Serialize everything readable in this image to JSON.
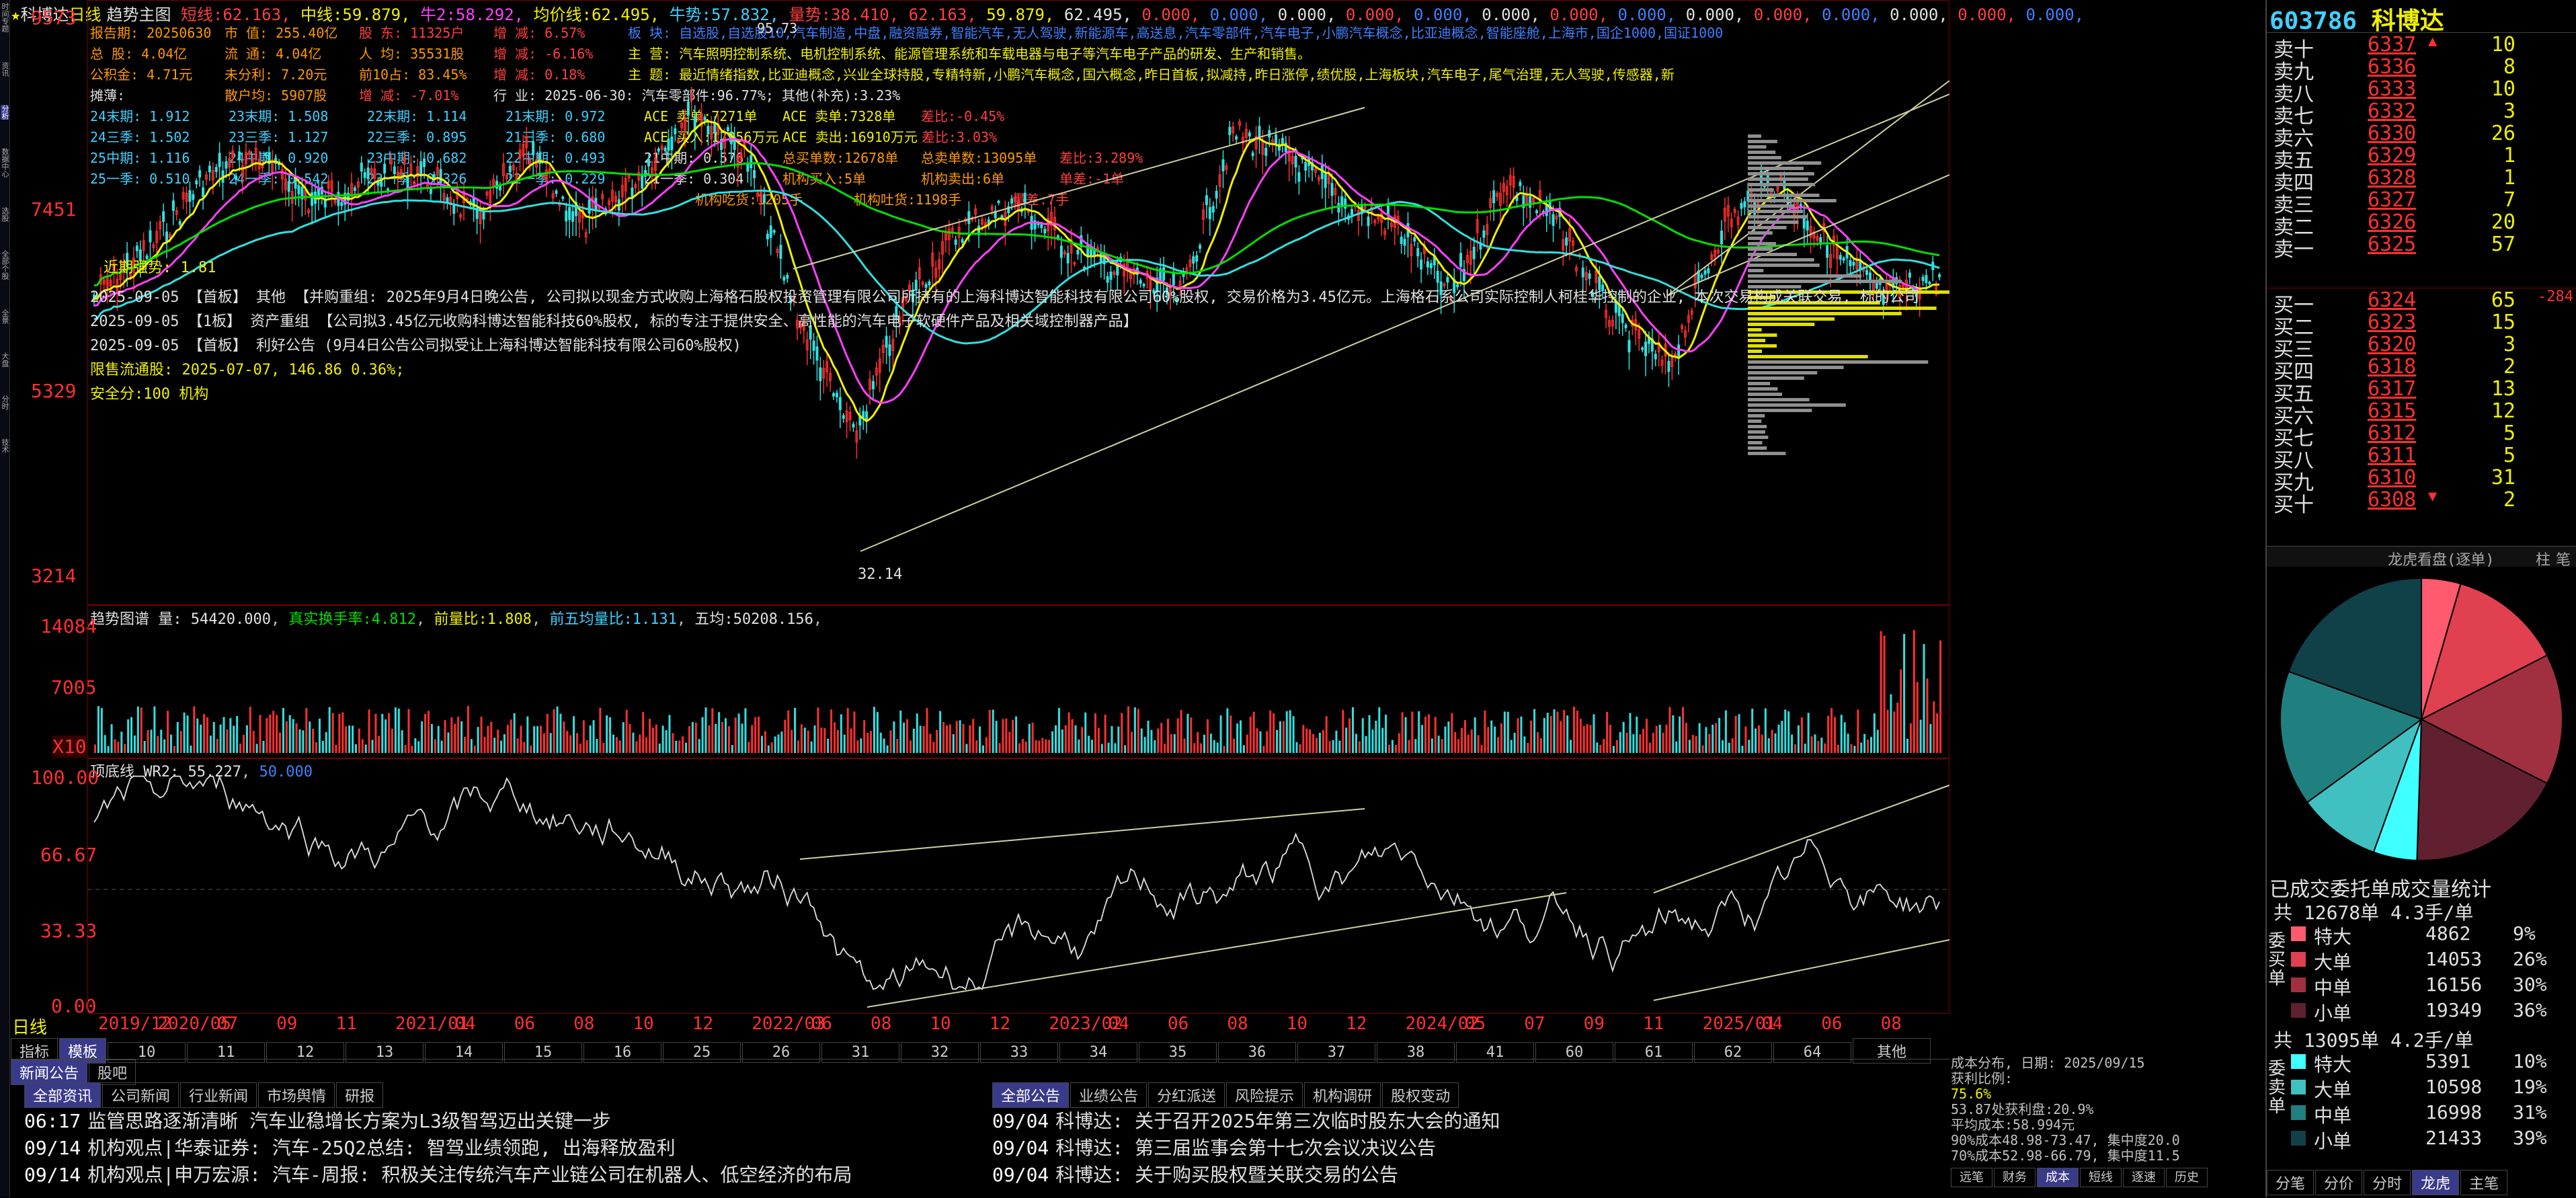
{
  "stock": {
    "code": "603786",
    "name": "科博达",
    "period": "日线",
    "theme": "趋势主图"
  },
  "header_ma": [
    {
      "label": "短线:",
      "value": "62.163",
      "color": "#ff4040"
    },
    {
      "label": "中线:",
      "value": "59.879",
      "color": "#f0f000"
    },
    {
      "label": "牛2:",
      "value": "58.292",
      "color": "#ff40ff"
    },
    {
      "label": "均价线:",
      "value": "62.495",
      "color": "#f0f000"
    },
    {
      "label": "牛势:",
      "value": "57.832",
      "color": "#40d0ff"
    },
    {
      "label": "量势:",
      "value": "38.410",
      "color": "#ff4040"
    },
    {
      "label": "",
      "value": "62.163",
      "color": "#ff4040"
    },
    {
      "label": "",
      "value": "59.879",
      "color": "#f0f000"
    },
    {
      "label": "",
      "value": "62.495",
      "color": "#e0e0e0"
    }
  ],
  "header_zero": "0.000",
  "info_rows": [
    [
      {
        "t": "报告期: 20250630",
        "c": "#ff9900"
      },
      {
        "t": "市 值: 255.40亿",
        "c": "#ff9900"
      },
      {
        "t": "股 东: 11325户",
        "c": "#ff4040"
      },
      {
        "t": "增 减: 6.57%",
        "c": "#ff4040"
      },
      {
        "t": "板 块: 自选股,自选股10,汽车制造,中盘,融资融券,智能汽车,无人驾驶,新能源车,高送息,汽车零部件,汽车电子,小鹏汽车概念,比亚迪概念,智能座舱,上海市,国企1000,国证1000",
        "c": "#4080ff"
      }
    ],
    [
      {
        "t": "总 股: 4.04亿",
        "c": "#ff9900"
      },
      {
        "t": "流 通: 4.04亿",
        "c": "#ff9900"
      },
      {
        "t": "人 均: 35531股",
        "c": "#ff9900"
      },
      {
        "t": "增 减: -6.16%",
        "c": "#ff4040"
      },
      {
        "t": "主 营: 汽车照明控制系统、电机控制系统、能源管理系统和车载电器与电子等汽车电子产品的研发、生产和销售。",
        "c": "#f0f000"
      }
    ],
    [
      {
        "t": "公积金: 4.71元",
        "c": "#ff9900"
      },
      {
        "t": "未分利: 7.20元",
        "c": "#ff9900"
      },
      {
        "t": "前10占: 83.45%",
        "c": "#ff9900"
      },
      {
        "t": "增 减: 0.18%",
        "c": "#ff4040"
      },
      {
        "t": "主 题: 最近情绪指数,比亚迪概念,兴业全球持股,专精特新,小鹏汽车概念,国六概念,昨日首板,拟减持,昨日涨停,绩优股,上海板块,汽车电子,尾气治理,无人驾驶,传感器,新",
        "c": "#f0f000"
      }
    ],
    [
      {
        "t": "摊薄:",
        "c": "#e0e0e0"
      },
      {
        "t": "散户均: 5907股",
        "c": "#ff9900"
      },
      {
        "t": "增 减: -7.01%",
        "c": "#ff4040"
      },
      {
        "t": "行 业: 2025-06-30: 汽车零部件:96.77%; 其他(补充):3.23%",
        "c": "#e0e0e0"
      }
    ]
  ],
  "stats_rows": [
    [
      "24末期: 1.912",
      "23末期: 1.508",
      "22末期: 1.114",
      "21末期: 0.972",
      "ACE 卖单:7271单",
      "ACE 卖单:7328单",
      "差比:-0.45%"
    ],
    [
      "24三季: 1.502",
      "23三季: 1.127",
      "22三季: 0.895",
      "21三季: 0.680",
      "ACE 买入:17956万元",
      "ACE 卖出:16910万元",
      "差比:3.03%"
    ],
    [
      "25中期: 1.116",
      "24中期: 0.920",
      "23中期: 0.682",
      "22中期: 0.493",
      "21中期: 0.576",
      "总买单数:12678单",
      "总卖单数:13095单",
      "差比:3.289%"
    ],
    [
      "25一季: 0.510",
      "24一季: 0.542",
      "23一季: 0.326",
      "22一季: 0.229",
      "21一季: 0.304",
      "机构买入:5单",
      "机构卖出:6单",
      "单差:-1单"
    ],
    [
      "机构吃货:1205手",
      "机构吐货:1198手",
      "量差:7手"
    ]
  ],
  "price_axis": [
    "9573",
    "7451",
    "5329",
    "3214"
  ],
  "price_notes": {
    "high_mark": "95.73",
    "low_mark": "32.14",
    "recent": "近期强势: 1.81"
  },
  "announcements": [
    "2025-09-05 【首板】 其他 【并购重组: 2025年9月4日晚公告, 公司拟以现金方式收购上海格石股权投资管理有限公司所持有的上海科博达智能科技有限公司60%股权, 交易价格为3.45亿元。上海格石系公司实际控制人柯桂华控制的企业, 本次交易构成关联交易, 标的公司",
    "2025-09-05 【1板】 资产重组 【公司拟3.45亿元收购科博达智能科技60%股权, 标的专注于提供安全、高性能的汽车电子软硬件产品及相关域控制器产品】",
    "2025-09-05 【首板】 利好公告 (9月4日公告公司拟受让上海科博达智能科技有限公司60%股权)",
    "限售流通股: 2025-07-07, 146.86 0.36%;",
    "安全分:100 机构"
  ],
  "volume": {
    "title": "趋势图谱 量:",
    "vol": "54420.000",
    "turn_label": "真实换手率:",
    "turn": "4.812",
    "vr_label": "前量比:",
    "vr": "1.808",
    "avg_label": "前五均量比:",
    "avg": "1.131",
    "five_label": "五均:",
    "five": "50208.156",
    "axis": [
      "14084",
      "7005",
      "X10"
    ]
  },
  "indicator": {
    "title": "顶底线 WR2:",
    "value": "55.227",
    "value2": "50.000",
    "axis": [
      "100.00",
      "66.67",
      "33.33",
      "0.00"
    ]
  },
  "date_axis": [
    "2019/12",
    "2020/05",
    "07",
    "09",
    "11",
    "2021/01",
    "04",
    "06",
    "08",
    "10",
    "12",
    "2022/03",
    "06",
    "08",
    "10",
    "12",
    "2023/02",
    "04",
    "06",
    "08",
    "10",
    "12",
    "2024/02",
    "05",
    "07",
    "09",
    "11",
    "2025/01",
    "04",
    "06",
    "08"
  ],
  "bottom_tabs": [
    "指标",
    "模板",
    "10",
    "11",
    "12",
    "13",
    "14",
    "15",
    "16",
    "25",
    "26",
    "31",
    "32",
    "33",
    "34",
    "35",
    "36",
    "37",
    "38",
    "41",
    "60",
    "61",
    "62",
    "64",
    "其他"
  ],
  "news_left": {
    "tabs": [
      "全部资讯",
      "公司新闻",
      "行业新闻",
      "市场舆情",
      "研报"
    ],
    "items": [
      {
        "time": "06:17",
        "text": "监管思路逐渐清晰 汽车业稳增长方案为L3级智驾迈出关键一步"
      },
      {
        "time": "09/14",
        "text": "机构观点|华泰证券: 汽车-25Q2总结: 智驾业绩领跑, 出海释放盈利"
      },
      {
        "time": "09/14",
        "text": "机构观点|申万宏源: 汽车-周报: 积极关注传统汽车产业链公司在机器人、低空经济的布局"
      }
    ]
  },
  "news_right": {
    "tabs": [
      "全部公告",
      "业绩公告",
      "分红派送",
      "风险提示",
      "机构调研",
      "股权变动"
    ],
    "items": [
      {
        "time": "09/04",
        "text": "科博达: 关于召开2025年第三次临时股东大会的通知"
      },
      {
        "time": "09/04",
        "text": "科博达: 第三届监事会第十七次会议决议公告"
      },
      {
        "time": "09/04",
        "text": "科博达: 关于购买股权暨关联交易的公告"
      }
    ]
  },
  "news_top_tabs": [
    "新闻公告",
    "股吧"
  ],
  "cost": {
    "lines": [
      "成本分布, 日期: 2025/09/15",
      "获利比例:",
      "75.6%",
      "53.87处获利盘:20.9%",
      "平均成本:58.994元",
      "90%成本48.98-73.47, 集中度20.0",
      "70%成本52.98-66.79, 集中度11.5"
    ],
    "tabs": [
      "远笔",
      "财务",
      "成本",
      "短线",
      "逐速",
      "历史"
    ]
  },
  "order_book": {
    "sell": [
      {
        "label": "卖十",
        "price": "6337",
        "vol": "10",
        "mark": "▲"
      },
      {
        "label": "卖九",
        "price": "6336",
        "vol": "8"
      },
      {
        "label": "卖八",
        "price": "6333",
        "vol": "10"
      },
      {
        "label": "卖七",
        "price": "6332",
        "vol": "3"
      },
      {
        "label": "卖六",
        "price": "6330",
        "vol": "26"
      },
      {
        "label": "卖五",
        "price": "6329",
        "vol": "1"
      },
      {
        "label": "卖四",
        "price": "6328",
        "vol": "1"
      },
      {
        "label": "卖三",
        "price": "6327",
        "vol": "7"
      },
      {
        "label": "卖二",
        "price": "6326",
        "vol": "20"
      },
      {
        "label": "卖一",
        "price": "6325",
        "vol": "57"
      }
    ],
    "buy": [
      {
        "label": "买一",
        "price": "6324",
        "vol": "65",
        "extra": "-284"
      },
      {
        "label": "买二",
        "price": "6323",
        "vol": "15"
      },
      {
        "label": "买三",
        "price": "6320",
        "vol": "3"
      },
      {
        "label": "买四",
        "price": "6318",
        "vol": "2"
      },
      {
        "label": "买五",
        "price": "6317",
        "vol": "13"
      },
      {
        "label": "买六",
        "price": "6315",
        "vol": "12"
      },
      {
        "label": "买七",
        "price": "6312",
        "vol": "5"
      },
      {
        "label": "买八",
        "price": "6311",
        "vol": "5"
      },
      {
        "label": "买九",
        "price": "6310",
        "vol": "31"
      },
      {
        "label": "买十",
        "price": "6308",
        "vol": "2",
        "mark": "▼"
      }
    ],
    "hand_mark": "手"
  },
  "pie_header": {
    "title": "龙虎看盘(逐单)",
    "tabs": [
      "柱",
      "笔"
    ]
  },
  "pie_data": [
    {
      "value": 9,
      "color": "#ff5a6e"
    },
    {
      "value": 26,
      "color": "#e04050"
    },
    {
      "value": 30,
      "color": "#a03040"
    },
    {
      "value": 36,
      "color": "#602030"
    },
    {
      "value": 10,
      "color": "#40ffff"
    },
    {
      "value": 19,
      "color": "#40c0c0"
    },
    {
      "value": 31,
      "color": "#208080"
    },
    {
      "value": 39,
      "color": "#104048"
    }
  ],
  "order_stats": {
    "title": "已成交委托单成交量统计",
    "buy_total": "共 12678单 4.3手/单",
    "sell_total": "共 13095单 4.2手/单",
    "side_buy": "委买单",
    "side_sell": "委卖单",
    "buy": [
      {
        "k": "特大",
        "v": "4862",
        "p": "9%",
        "color": "#ff5a6e"
      },
      {
        "k": "大单",
        "v": "14053",
        "p": "26%",
        "color": "#e04050"
      },
      {
        "k": "中单",
        "v": "16156",
        "p": "30%",
        "color": "#a03040"
      },
      {
        "k": "小单",
        "v": "19349",
        "p": "36%",
        "color": "#602030"
      }
    ],
    "sell": [
      {
        "k": "特大",
        "v": "5391",
        "p": "10%",
        "color": "#40ffff"
      },
      {
        "k": "大单",
        "v": "10598",
        "p": "19%",
        "color": "#40c0c0"
      },
      {
        "k": "中单",
        "v": "16998",
        "p": "31%",
        "color": "#208080"
      },
      {
        "k": "小单",
        "v": "21433",
        "p": "39%",
        "color": "#104048"
      }
    ]
  },
  "right_bottom_tabs": [
    "分笔",
    "分价",
    "分时",
    "龙虎",
    "主笔"
  ],
  "sidebar_tabs": [
    "时间专题",
    "资讯",
    "分析",
    "数据中心",
    "选股",
    "全部个股",
    "全景",
    "大盘",
    "分时",
    "技术"
  ]
}
